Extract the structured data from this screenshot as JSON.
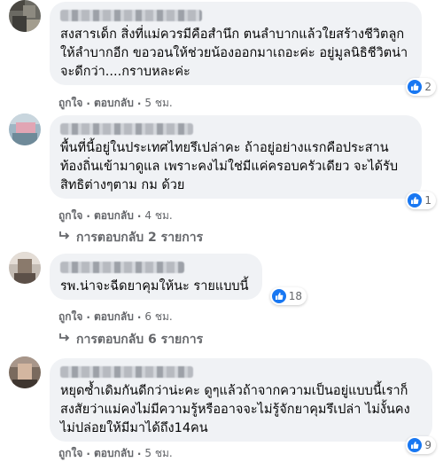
{
  "comments": [
    {
      "text": "สงสารเด็ก สิ่งที่แม่ควรมีคือสำนึก ตนลำบากแล้วใยสร้างชีวิตลูก\nให้ลำบากอีก ขอวอนให้ช่วยน้องออกมาเถอะค่ะ อยู่มูลนิธิชีวิตน่า\nจะดีกว่า....กราบหละค่ะ",
      "reaction_count": "2",
      "like_label": "ถูกใจ",
      "reply_label": "ตอบกลับ",
      "time": "5 ชม."
    },
    {
      "text": "พื้นที่นี้อยู่ในประเทศไทยรึเปล่าคะ ถ้าอยู่อย่างแรกคือประสาน\nท้องถิ่นเข้ามาดูแล เพราะคงไม่ใช่มีแค่ครอบครัวเดียว จะได้รับ\nสิทธิต่างๆตาม กม ด้วย",
      "reaction_count": "1",
      "like_label": "ถูกใจ",
      "reply_label": "ตอบกลับ",
      "time": "4 ชม.",
      "replies_label": "การตอบกลับ 2 รายการ"
    },
    {
      "text": "รพ.น่าจะฉีดยาคุมให้นะ รายแบบนี้",
      "reaction_count": "18",
      "like_label": "ถูกใจ",
      "reply_label": "ตอบกลับ",
      "time": "6 ชม.",
      "replies_label": "การตอบกลับ 6 รายการ"
    },
    {
      "text": "หยุดซ้ำเดิมกันดีกว่าน่ะคะ ดูๆแล้วถ้าจากความเป็นอยู่แบบนี้เราก็\nสงสัยว่าแม่คงไม่มีความรู้หรืออาจจะไม่รู้จักยาคุมรึเปล่า ไม่งั้นคง\nไม่ปล่อยให้มีมาได้ถึง14คน",
      "reaction_count": "9",
      "like_label": "ถูกใจ",
      "reply_label": "ตอบกลับ",
      "time": "5 ชม."
    }
  ],
  "colors": {
    "bubble": "#f0f2f5",
    "meta_text": "#65676b",
    "like_blue": "#1877f2"
  },
  "icons": {
    "reaction": "like-icon",
    "replies": "reply-arrow-icon"
  }
}
